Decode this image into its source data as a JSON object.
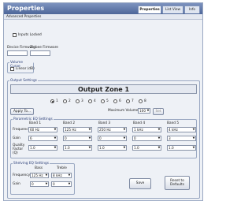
{
  "window": {
    "title": "Properties"
  },
  "tabs": [
    {
      "label": "Properties",
      "active": true
    },
    {
      "label": "List View",
      "active": false
    },
    {
      "label": "Info",
      "active": false
    }
  ],
  "subbar": {
    "label": "Advanced Properties"
  },
  "inputs_locked": {
    "label": "Inputs Locked",
    "checked": false
  },
  "device_firmware": {
    "label": "Device Firmware",
    "value": ""
  },
  "zigbee_firmware": {
    "label": "Zigbee Firmware",
    "value": ""
  },
  "volume_curve": {
    "group_label": "Volume Curve",
    "linear_label": "Linear (dB)",
    "checked": false
  },
  "output_settings": {
    "group_label": "Output Settings",
    "zone_title": "Output Zone 1",
    "zones": [
      "1",
      "2",
      "3",
      "4",
      "5",
      "6",
      "7",
      "8"
    ],
    "selected_zone": "1",
    "apply_label": "Apply To...",
    "max_volume_label": "Maximum Volume",
    "max_volume_value": "100",
    "set_label": "Set"
  },
  "peq": {
    "group_label": "Parametric EQ Settings",
    "bands": [
      "Band 1",
      "Band 2",
      "Band 3",
      "Band 4",
      "Band 5"
    ],
    "rows": [
      {
        "label": "Frequency",
        "values": [
          "60 Hz",
          "125 Hz",
          "250 Hz",
          "1 kHz",
          "4 kHz"
        ]
      },
      {
        "label": "Gain",
        "values": [
          "6",
          "0",
          "0",
          "0",
          "3"
        ]
      },
      {
        "label": "Quality Factor (Q)",
        "values": [
          "1.0",
          "1.0",
          "1.0",
          "1.0",
          "1.0"
        ]
      }
    ]
  },
  "shelving": {
    "group_label": "Shelving EQ Settings",
    "cols": [
      "Bass",
      "Treble"
    ],
    "frequency_label": "Frequency",
    "gain_label": "Gain",
    "freq_values": [
      "125 Hz",
      "8 kHz"
    ],
    "gain_values": [
      "0",
      "0"
    ]
  },
  "buttons": {
    "save": "Save",
    "reset": "Reset to Defaults"
  },
  "colors": {
    "titlebar": "#4d6699",
    "group_label": "#2a3e78"
  }
}
